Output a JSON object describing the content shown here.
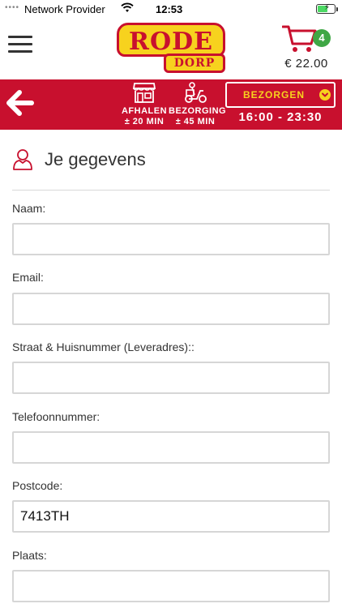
{
  "status_bar": {
    "signal": "••••",
    "carrier": "Network Provider",
    "time": "12:53"
  },
  "header": {
    "logo_top": "RODE",
    "logo_bottom": "DORP",
    "cart_count": "4",
    "cart_total": "€ 22.00"
  },
  "order_bar": {
    "pickup_label": "AFHALEN",
    "pickup_time": "± 20 MIN",
    "delivery_label": "BEZORGING",
    "delivery_time": "± 45 MIN",
    "mode_selected": "BEZORGEN",
    "time_range": "16:00 - 23:30"
  },
  "form": {
    "title": "Je gegevens",
    "fields": [
      {
        "label": "Naam:",
        "value": ""
      },
      {
        "label": "Email:",
        "value": ""
      },
      {
        "label": "Straat & Huisnummer (Leveradres)::",
        "value": ""
      },
      {
        "label": "Telefoonnummer:",
        "value": ""
      },
      {
        "label": "Postcode:",
        "value": "7413TH"
      },
      {
        "label": "Plaats:",
        "value": ""
      }
    ]
  },
  "colors": {
    "brand_red": "#c8102e",
    "brand_yellow": "#f7d21e",
    "badge_green": "#3fa745"
  },
  "icons": {
    "menu": "hamburger-icon",
    "cart": "cart-icon",
    "back": "arrow-left-icon",
    "pickup": "store-icon",
    "delivery": "scooter-icon",
    "dropdown": "chevron-down-icon",
    "section": "user-icon"
  }
}
